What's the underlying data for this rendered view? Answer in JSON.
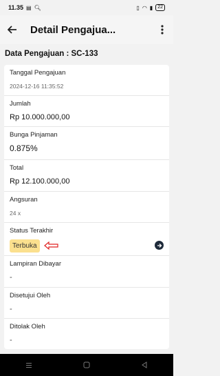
{
  "status_bar": {
    "time": "11.35",
    "battery": "22"
  },
  "app_bar": {
    "title": "Detail Pengajua..."
  },
  "section": {
    "title": "Data Pengajuan : SC-133"
  },
  "fields": [
    {
      "label": "Tanggal Pengajuan",
      "value": "2024-12-16 11:35:52"
    },
    {
      "label": "Jumlah",
      "value": "Rp 10.000.000,00"
    },
    {
      "label": "Bunga Pinjaman",
      "value": "0.875%"
    },
    {
      "label": "Total",
      "value": "Rp 12.100.000,00"
    },
    {
      "label": "Angsuran",
      "value": "24 x"
    },
    {
      "label": "Status Terakhir",
      "value": "Terbuka"
    },
    {
      "label": "Lampiran Dibayar",
      "value": "-"
    },
    {
      "label": "Disetujui Oleh",
      "value": "-"
    },
    {
      "label": "Ditolak Oleh",
      "value": "-"
    }
  ],
  "colors": {
    "badge_bg": "#fbe08e",
    "annotation_arrow": "#e02020",
    "go_button": "#1e2a3a"
  },
  "icons": {
    "back": "arrow-left-icon",
    "more": "more-vertical-icon",
    "go": "arrow-right-circle-icon",
    "nav_recent": "menu-lines-icon",
    "nav_home": "square-icon",
    "nav_back": "triangle-back-icon"
  }
}
